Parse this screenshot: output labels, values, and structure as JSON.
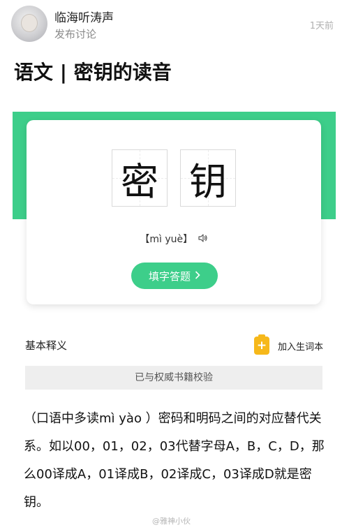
{
  "post": {
    "username": "临海听涛声",
    "action": "发布讨论",
    "time": "1天前",
    "title": "语文 | 密钥的读音"
  },
  "word_card": {
    "characters": [
      "密",
      "钥"
    ],
    "pinyin": "【mì yuè】",
    "speaker_icon": "speaker-icon",
    "quiz_button": "填字答题 ",
    "accent_color": "#3dce8a"
  },
  "section": {
    "title": "基本释义",
    "add_vocab_label": "加入生词本",
    "vocab_icon": "notebook-plus-icon",
    "vocab_icon_color": "#f6b81a"
  },
  "verified_text": "已与权威书籍校验",
  "definition": "（口语中多读mì yào ）密码和明码之间的对应替代关系。如以00，01，02，03代替字母A，B，C，D，那么00译成A，01译成B，02译成C，03译成D就是密钥。",
  "watermark": "@雅神小伙"
}
